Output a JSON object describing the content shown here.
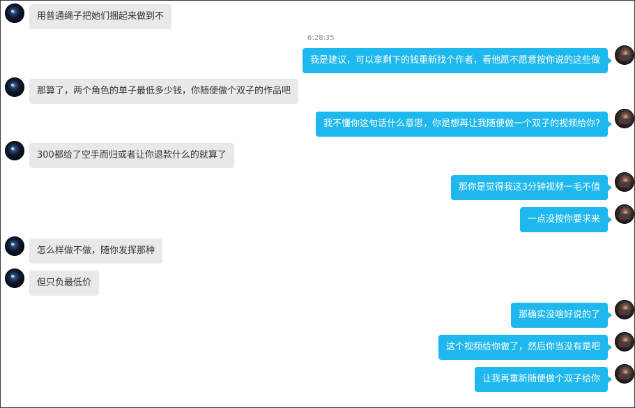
{
  "timestamp": "6:28:35",
  "messages": [
    {
      "side": "left",
      "text": "用普通绳子把她们捆起来做到不"
    },
    {
      "side": "right",
      "text": "我是建议，可以拿剩下的钱重新找个作者，看他愿不愿意按你说的这些做"
    },
    {
      "side": "left",
      "text": "那算了，两个角色的单子最低多少钱，你随便做个双子的作品吧"
    },
    {
      "side": "right",
      "text": "我不懂你这句话什么意思，你是想再让我随便做一个双子的视频给你?"
    },
    {
      "side": "left",
      "text": "300都给了空手而归或者让你退款什么的就算了"
    },
    {
      "side": "right",
      "text": "那你是觉得我这3分钟视频一毛不值"
    },
    {
      "side": "right",
      "text": "一点没按你要求来"
    },
    {
      "side": "left",
      "text": "怎么样做不做，随你发挥那种"
    },
    {
      "side": "left",
      "text": "但只负最低价"
    },
    {
      "side": "right",
      "text": "那确实没啥好说的了"
    },
    {
      "side": "right",
      "text": "这个视频给你做了，然后你当没有是吧"
    },
    {
      "side": "right",
      "text": "让我再重新随便做个双子给你"
    }
  ]
}
